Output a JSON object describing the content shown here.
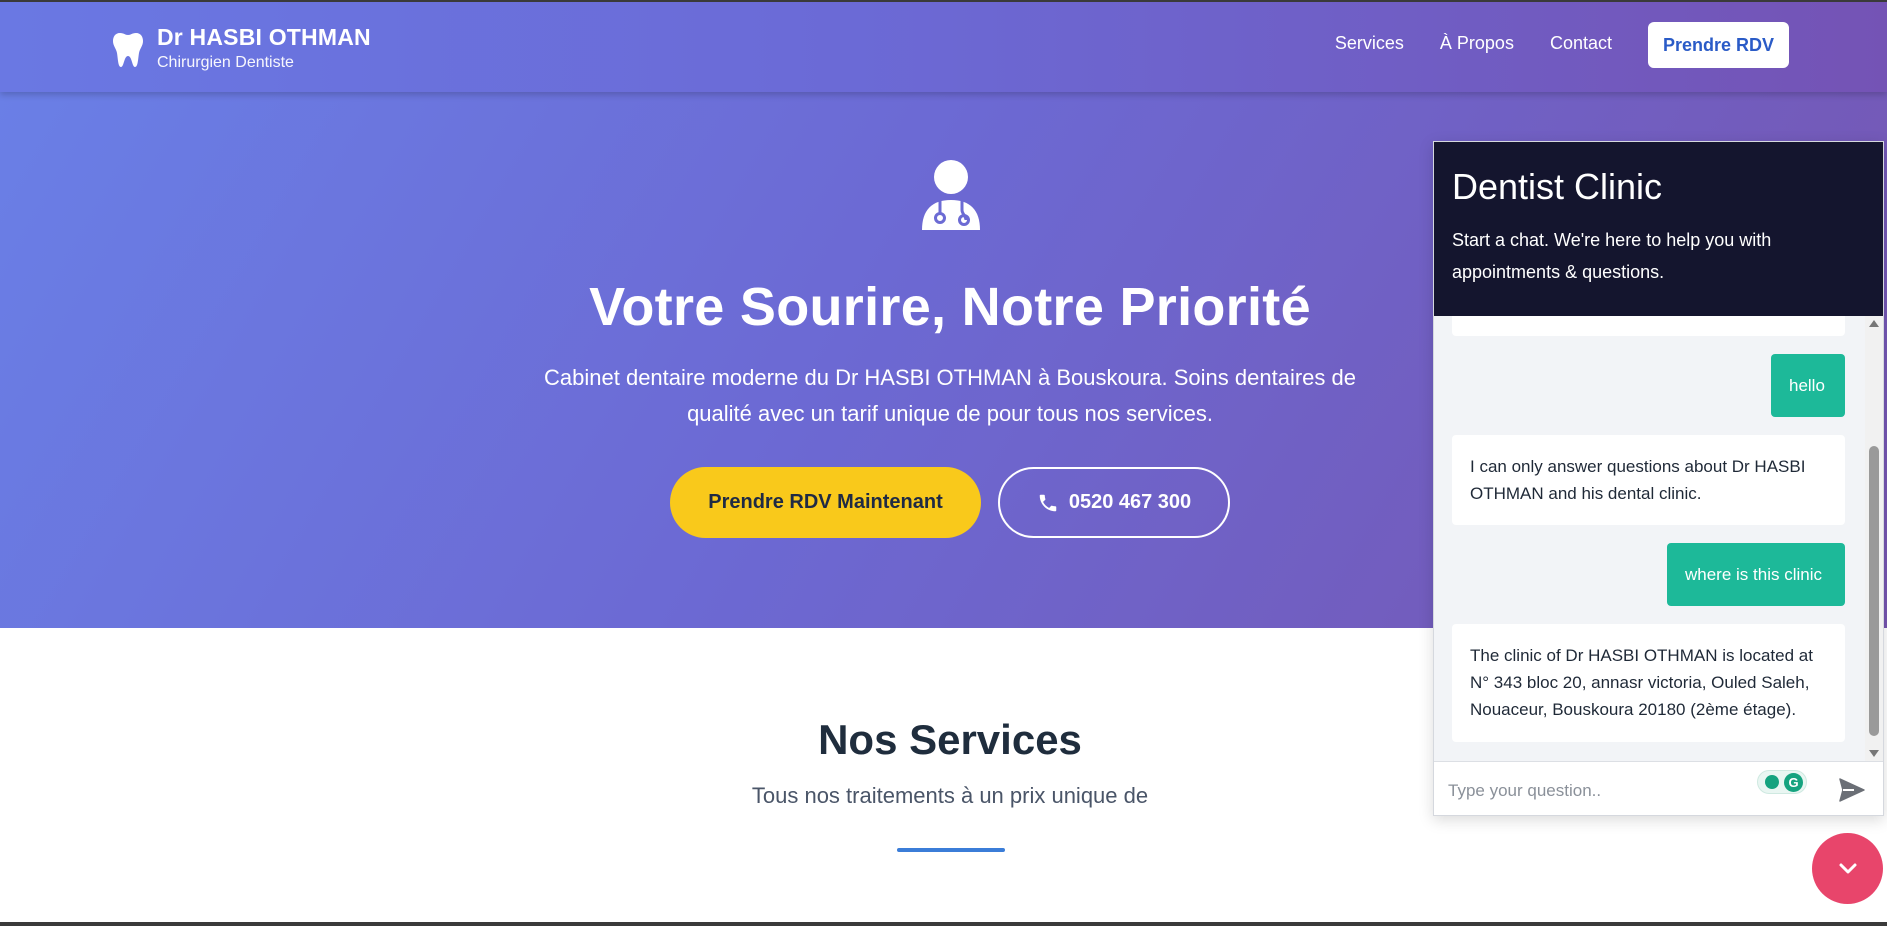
{
  "header": {
    "brand_name": "Dr HASBI OTHMAN",
    "brand_subtitle": "Chirurgien Dentiste",
    "nav": [
      "Services",
      "À Propos",
      "Contact"
    ],
    "cta": "Prendre RDV"
  },
  "hero": {
    "title": "Votre Sourire, Notre Priorité",
    "description": "Cabinet dentaire moderne du Dr HASBI OTHMAN à Bouskoura. Soins dentaires de qualité avec un tarif unique de pour tous nos services.",
    "primary_button": "Prendre RDV Maintenant",
    "phone": "0520 467 300"
  },
  "services": {
    "title": "Nos Services",
    "subtitle": "Tous nos traitements à un prix unique de"
  },
  "chat": {
    "title": "Dentist Clinic",
    "description": "Start a chat. We're here to help you with appointments & questions.",
    "messages": [
      {
        "from": "bot",
        "text": ""
      },
      {
        "from": "user",
        "text": "hello"
      },
      {
        "from": "bot",
        "text": "I can only answer questions about Dr HASBI OTHMAN and his dental clinic."
      },
      {
        "from": "user",
        "text": "where is this clinic"
      },
      {
        "from": "bot",
        "text": "The clinic of Dr HASBI OTHMAN is located at N° 343 bloc 20, annasr victoria, Ouled Saleh, Nouaceur, Bouskoura 20180 (2ème étage)."
      }
    ],
    "input_placeholder": "Type your question..",
    "input_value": ""
  },
  "colors": {
    "accent_yellow": "#f9c91b",
    "chat_header": "#14152e",
    "user_bubble": "#1db999",
    "fab": "#e8456b"
  },
  "icons": {
    "brand": "tooth-icon",
    "hero": "doctor-icon",
    "phone": "phone-icon",
    "send": "send-icon",
    "fab": "chevron-down-icon"
  }
}
